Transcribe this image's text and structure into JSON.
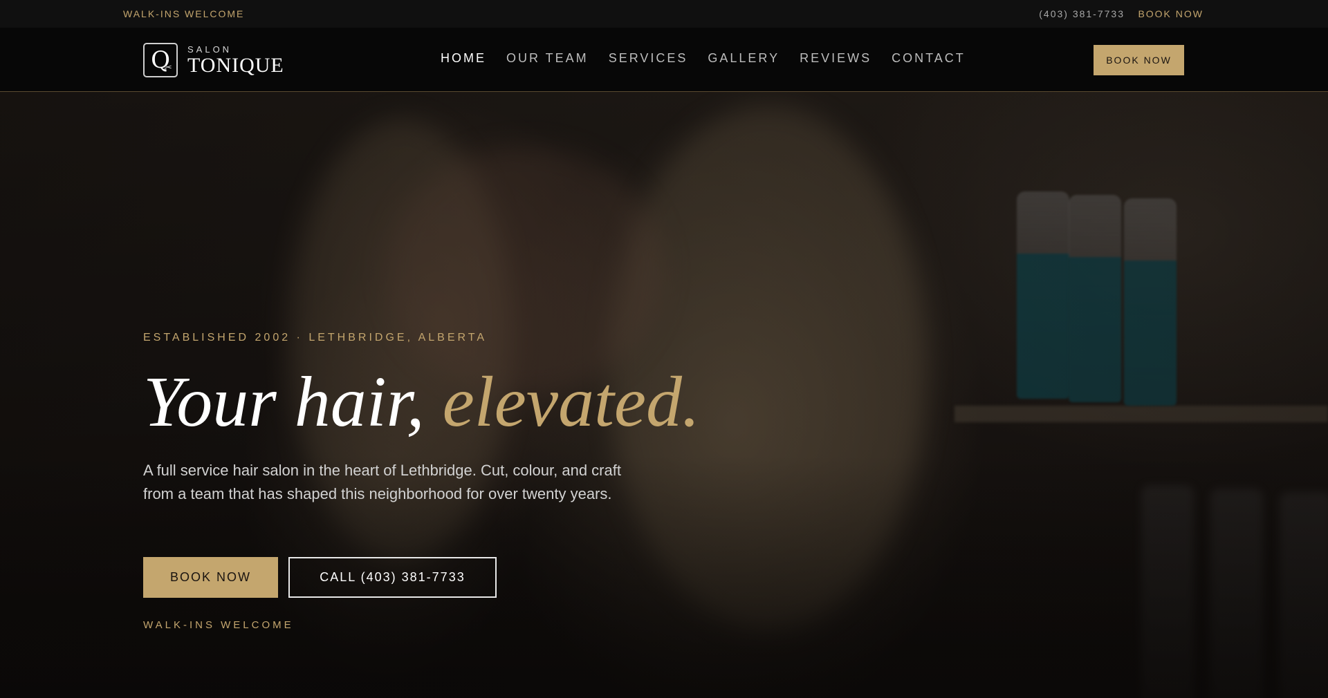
{
  "topbar": {
    "walkins": "WALK-INS WELCOME",
    "phone": "(403) 381-7733",
    "book": "BOOK NOW"
  },
  "brand": {
    "logo_mark": "Q",
    "small": "SALON",
    "name": "TONIQUE"
  },
  "nav": {
    "items": [
      {
        "label": "HOME",
        "active": true
      },
      {
        "label": "OUR TEAM",
        "active": false
      },
      {
        "label": "SERVICES",
        "active": false
      },
      {
        "label": "GALLERY",
        "active": false
      },
      {
        "label": "REVIEWS",
        "active": false
      },
      {
        "label": "CONTACT",
        "active": false
      }
    ],
    "book_label": "BOOK NOW"
  },
  "hero": {
    "eyebrow": "ESTABLISHED 2002 · LETHBRIDGE, ALBERTA",
    "headline_plain": "Your hair,",
    "headline_accent": "elevated.",
    "lede": "A full service hair salon in the heart of Lethbridge. Cut, colour, and craft from a team that has shaped this neighborhood for over twenty years.",
    "primary_cta": "BOOK NOW",
    "secondary_cta": "CALL (403) 381-7733",
    "walkins": "WALK-INS WELCOME"
  },
  "colors": {
    "accent": "#c4a66e",
    "nav_bg": "#070707",
    "topbar_bg": "#101010"
  },
  "icons": {
    "logo": "q-scissors-logo-icon"
  }
}
